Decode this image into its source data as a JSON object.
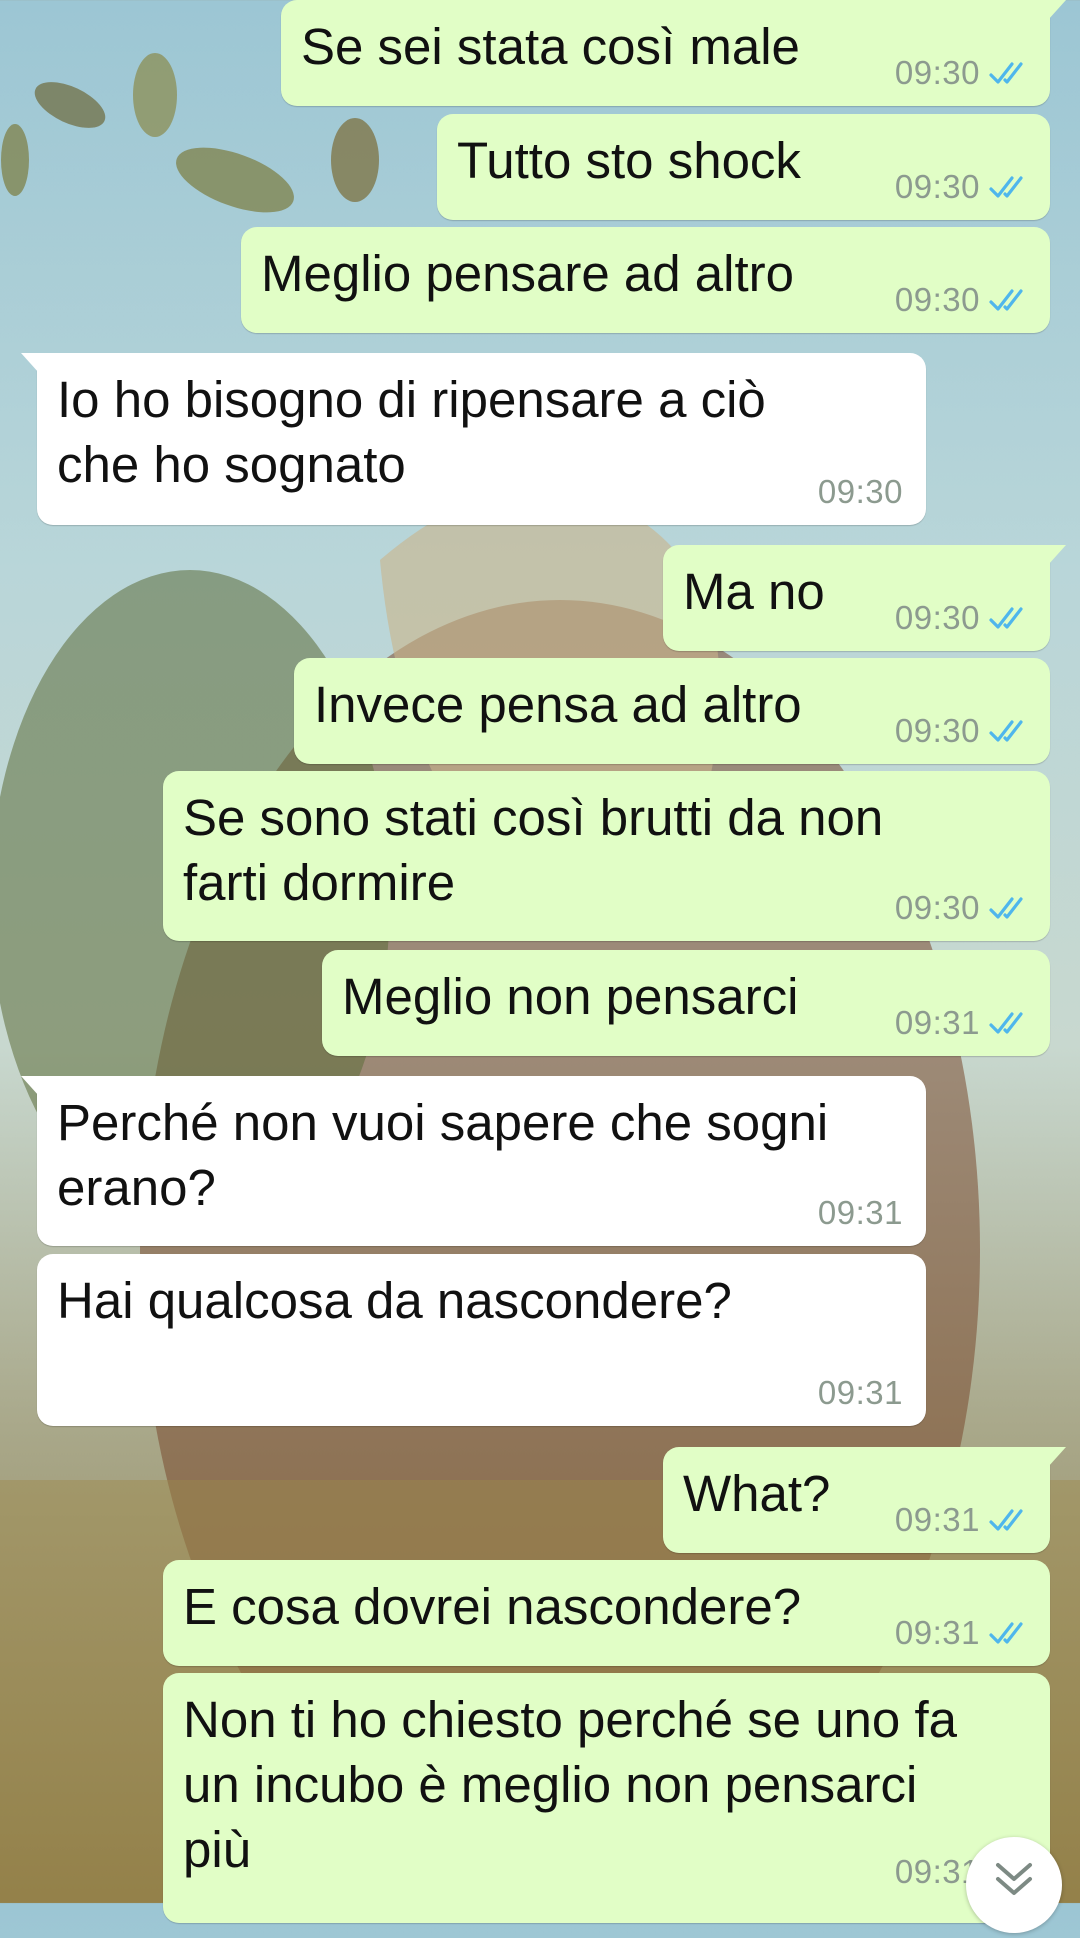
{
  "messages": [
    {
      "direction": "out",
      "text": "Se sei stata così male",
      "time": "09:30",
      "read": true
    },
    {
      "direction": "out",
      "text": "Tutto sto shock",
      "time": "09:30",
      "read": true
    },
    {
      "direction": "out",
      "text": "Meglio pensare ad altro",
      "time": "09:30",
      "read": true
    },
    {
      "direction": "in",
      "lines": [
        "Io ho bisogno di ripensare a ciò",
        "che ho sognato"
      ],
      "time": "09:30"
    },
    {
      "direction": "out",
      "text": "Ma no",
      "time": "09:30",
      "read": true
    },
    {
      "direction": "out",
      "text": "Invece pensa ad altro",
      "time": "09:30",
      "read": true
    },
    {
      "direction": "out",
      "lines": [
        "Se sono stati così brutti da non",
        "farti dormire"
      ],
      "time": "09:30",
      "read": true
    },
    {
      "direction": "out",
      "text": "Meglio non pensarci",
      "time": "09:31",
      "read": true
    },
    {
      "direction": "in",
      "lines": [
        "Perché non vuoi sapere che sogni",
        "erano?"
      ],
      "time": "09:31"
    },
    {
      "direction": "in",
      "text": "Hai qualcosa da nascondere?",
      "time": "09:31"
    },
    {
      "direction": "out",
      "text": "What?",
      "time": "09:31",
      "read": true
    },
    {
      "direction": "out",
      "text": "E cosa dovrei nascondere?",
      "time": "09:31",
      "read": true
    },
    {
      "direction": "out",
      "lines": [
        "Non ti ho chiesto perché se uno fa",
        "un incubo è meglio non pensarci",
        "più"
      ],
      "time": "09:31",
      "read": true
    }
  ],
  "colors": {
    "outgoing_bubble": "#e1fec6",
    "incoming_bubble": "#ffffff",
    "read_ticks": "#4fb6ec",
    "timestamp": "#8c9a8f"
  },
  "icons": {
    "read_receipt": "double-check-icon",
    "scroll_down": "double-chevron-down-icon"
  }
}
